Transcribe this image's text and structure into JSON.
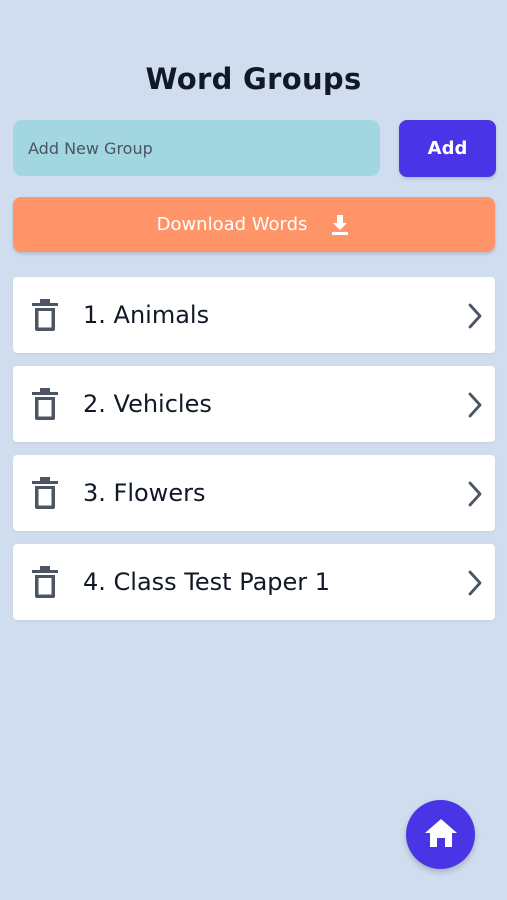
{
  "header": {
    "title": "Word Groups"
  },
  "new_group": {
    "placeholder": "Add New Group",
    "value": "",
    "add_label": "Add"
  },
  "download": {
    "label": "Download Words",
    "icon": "download-icon"
  },
  "groups": [
    {
      "label": "1. Animals"
    },
    {
      "label": "2. Vehicles"
    },
    {
      "label": "3. Flowers"
    },
    {
      "label": "4. Class Test Paper 1"
    }
  ],
  "icons": {
    "delete": "trash-icon",
    "open": "chevron-right-icon",
    "home": "home-icon"
  },
  "colors": {
    "background": "#d0ddef",
    "accent": "#4a35e6",
    "input": "#a2d6e0",
    "download": "#fe9467",
    "card": "#ffffff",
    "text": "#111827",
    "icon": "#4b5563"
  }
}
